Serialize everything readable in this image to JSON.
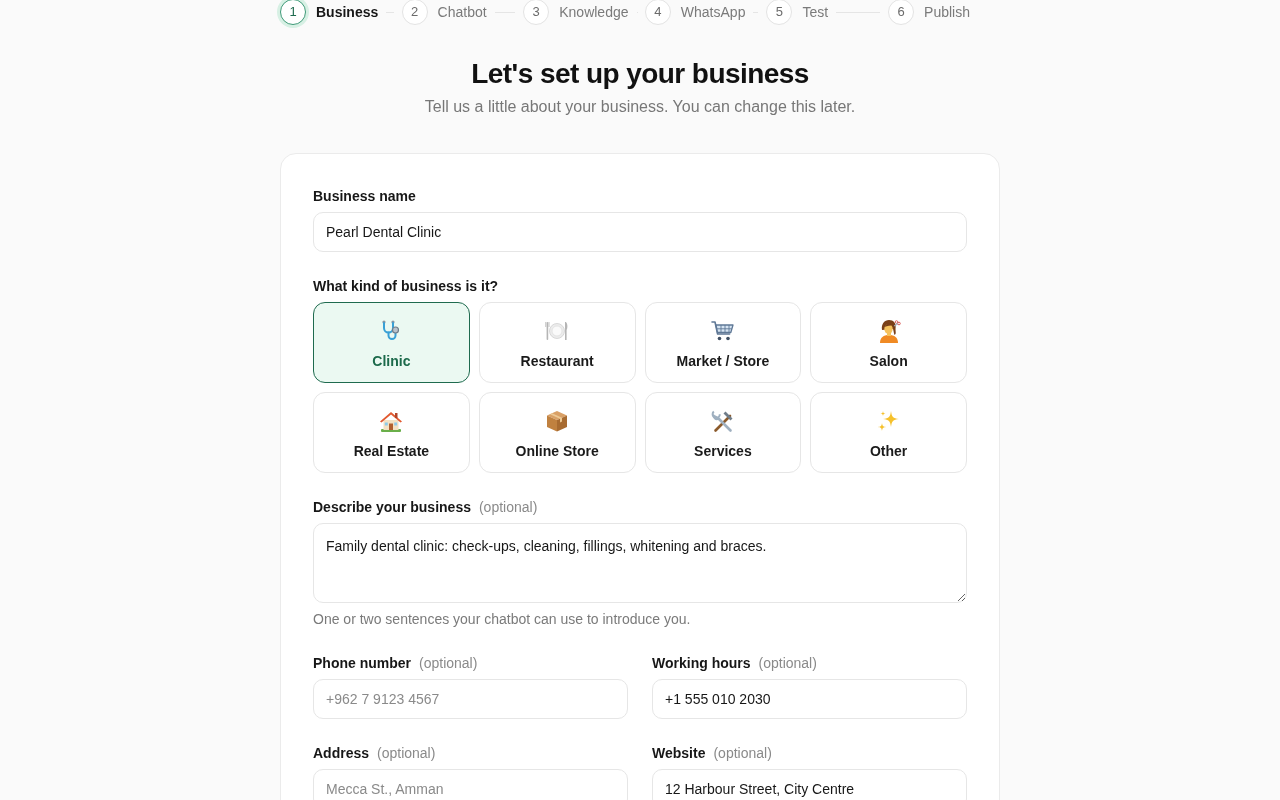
{
  "stepper": {
    "steps": [
      {
        "number": "1",
        "label": "Business",
        "selected": true
      },
      {
        "number": "2",
        "label": "Chatbot",
        "selected": false
      },
      {
        "number": "3",
        "label": "Knowledge",
        "selected": false
      },
      {
        "number": "4",
        "label": "WhatsApp",
        "selected": false
      },
      {
        "number": "5",
        "label": "Test",
        "selected": false
      },
      {
        "number": "6",
        "label": "Publish",
        "selected": false
      }
    ]
  },
  "header": {
    "title": "Let's set up your business",
    "subtitle": "Tell us a little about your business. You can change this later."
  },
  "form": {
    "business_name": {
      "label": "Business name",
      "value": "Pearl Dental Clinic"
    },
    "business_type": {
      "label": "What kind of business is it?",
      "options": [
        {
          "label": "Clinic",
          "selected": true
        },
        {
          "label": "Restaurant",
          "selected": false
        },
        {
          "label": "Market / Store",
          "selected": false
        },
        {
          "label": "Salon",
          "selected": false
        },
        {
          "label": "Real Estate",
          "selected": false
        },
        {
          "label": "Online Store",
          "selected": false
        },
        {
          "label": "Services",
          "selected": false
        },
        {
          "label": "Other",
          "selected": false
        }
      ]
    },
    "description": {
      "label": "Describe your business",
      "note": "(optional)",
      "value": "Family dental clinic: check-ups, cleaning, fillings, whitening and braces.",
      "hint": "One or two sentences your chatbot can use to introduce you."
    },
    "contact_fields": [
      {
        "label": "Phone number",
        "note": "(optional)",
        "placeholder": "+962 7 9123 4567"
      },
      {
        "label": "Working hours",
        "note": "(optional)",
        "value": "+1 555 010 2030"
      },
      {
        "label": "Address",
        "note": "(optional)",
        "placeholder": "Mecca St., Amman"
      },
      {
        "label": "Website",
        "note": "(optional)",
        "value": "12 Harbour Street, City Centre"
      }
    ]
  }
}
